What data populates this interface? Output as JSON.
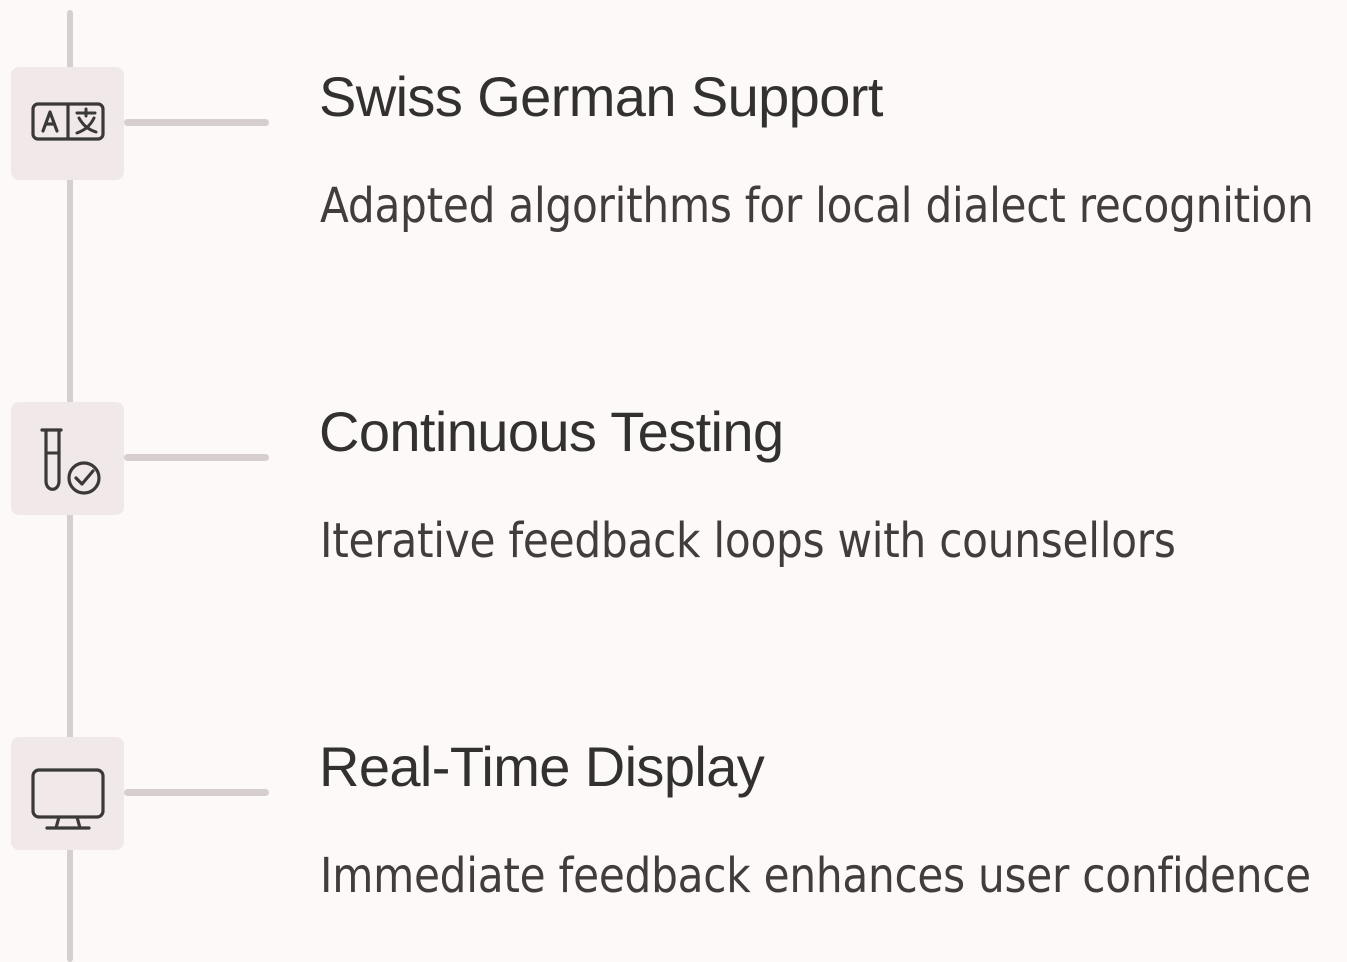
{
  "items": [
    {
      "title": "Swiss German Support",
      "description": "Adapted algorithms for local dialect recognition",
      "icon": "translate-icon"
    },
    {
      "title": "Continuous Testing",
      "description": "Iterative feedback loops with counsellors",
      "icon": "test-tube-check-icon"
    },
    {
      "title": "Real-Time Display",
      "description": "Immediate feedback enhances user confidence",
      "icon": "monitor-icon"
    }
  ],
  "colors": {
    "background": "#fcf9f8",
    "icon_background": "#f1e9e9",
    "timeline": "#d7cfcf",
    "text": "#333030"
  }
}
